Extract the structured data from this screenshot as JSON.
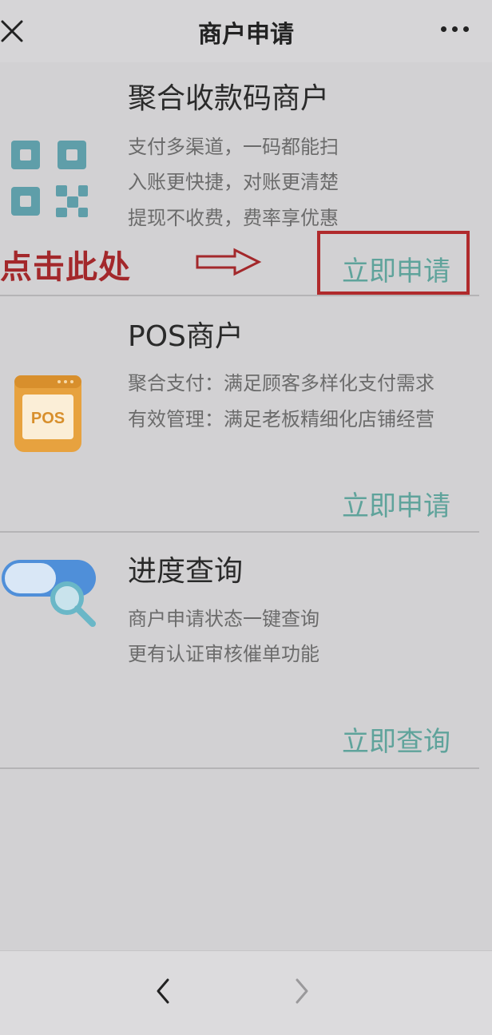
{
  "header": {
    "title": "商户申请",
    "close_icon": "close-icon",
    "more_icon": "more-icon"
  },
  "sections": [
    {
      "title": "聚合收款码商户",
      "icon": "qr-code-icon",
      "lines": [
        "支付多渠道，一码都能扫",
        "入账更快捷，对账更清楚",
        "提现不收费，费率享优惠"
      ],
      "action": "立即申请"
    },
    {
      "title": "POS商户",
      "icon": "pos-terminal-icon",
      "icon_text": "POS",
      "lines": [
        "聚合支付：满足顾客多样化支付需求",
        "有效管理：满足老板精细化店铺经营"
      ],
      "action": "立即申请"
    },
    {
      "title": "进度查询",
      "icon": "search-toggle-icon",
      "lines": [
        "商户申请状态一键查询",
        "更有认证审核催单功能"
      ],
      "action": "立即查询"
    }
  ],
  "annotation": {
    "text": "点击此处",
    "arrow_icon": "right-arrow-icon",
    "color": "#b02a2c"
  },
  "footer": {
    "back_icon": "chevron-left-icon",
    "forward_icon": "chevron-right-icon"
  },
  "colors": {
    "accent": "#5fa39b",
    "qr": "#5f9ea9",
    "pos": "#e7a23f",
    "background": "#d2d1d3"
  }
}
